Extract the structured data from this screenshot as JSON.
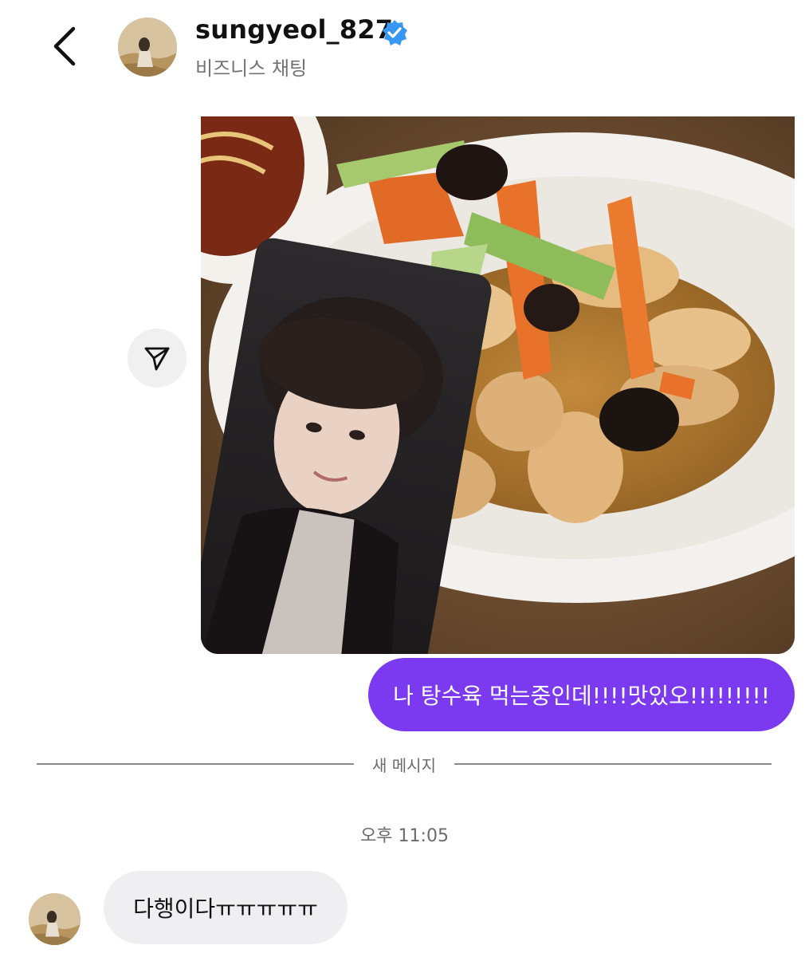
{
  "header": {
    "username": "sungyeol_827",
    "subtitle": "비즈니스 채팅",
    "verified": true,
    "back_icon": "chevron-left-icon",
    "verified_icon": "verified-badge-icon",
    "avatar": "profile-avatar"
  },
  "messages": {
    "photo_description_icon": "shared-photo",
    "share_icon": "send-icon",
    "sent_text": "나 탕수육 먹는중인데!!!!맛있오!!!!!!!!!",
    "divider_label": "새 메시지",
    "timestamp": "오후 11:05",
    "received_text": "다행이다ㅠㅠㅠㅠㅠ"
  },
  "colors": {
    "accent": "#7b3af0",
    "verified_blue": "#3897f0",
    "received_bubble": "#efeff1"
  }
}
